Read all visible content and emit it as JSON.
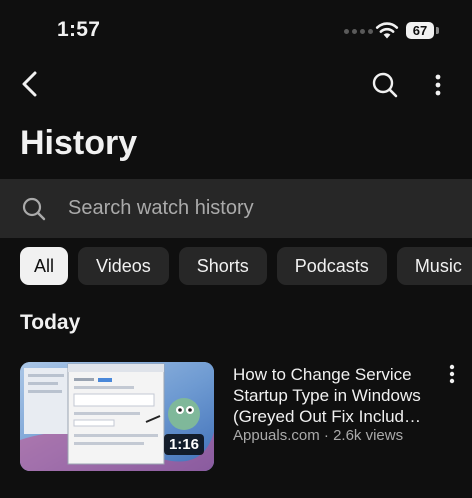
{
  "status": {
    "time": "1:57",
    "battery": "67"
  },
  "nav": {
    "back_icon": "back-chevron-icon",
    "search_icon": "search-icon",
    "more_icon": "more-vertical-icon"
  },
  "page": {
    "title": "History"
  },
  "search": {
    "placeholder": "Search watch history"
  },
  "filters": [
    {
      "label": "All",
      "active": true
    },
    {
      "label": "Videos",
      "active": false
    },
    {
      "label": "Shorts",
      "active": false
    },
    {
      "label": "Podcasts",
      "active": false
    },
    {
      "label": "Music",
      "active": false
    }
  ],
  "sections": [
    {
      "title": "Today",
      "videos": [
        {
          "title_lines": [
            "How to Change Service",
            "Startup Type in Windows",
            "(Greyed Out Fix Includ…"
          ],
          "channel": "Appuals.com",
          "separator": "·",
          "views": "2.6k views",
          "duration": "1:16"
        }
      ]
    }
  ],
  "colors": {
    "background": "#0f0f0f",
    "surface": "#272727",
    "text_primary": "#f1f1f1",
    "text_secondary": "#aaaaaa",
    "chip_active_bg": "#f1f1f1"
  }
}
